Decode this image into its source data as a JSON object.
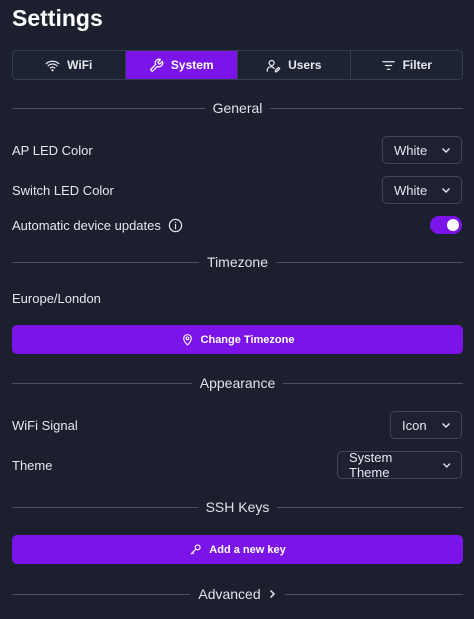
{
  "page": {
    "title": "Settings"
  },
  "tabs": [
    {
      "label": "WiFi",
      "icon": "wifi-icon",
      "active": false
    },
    {
      "label": "System",
      "icon": "wrench-icon",
      "active": true
    },
    {
      "label": "Users",
      "icon": "users-icon",
      "active": false
    },
    {
      "label": "Filter",
      "icon": "filter-icon",
      "active": false
    }
  ],
  "sections": {
    "general": "General",
    "timezone": "Timezone",
    "appearance": "Appearance",
    "ssh_keys": "SSH Keys",
    "advanced": "Advanced"
  },
  "general": {
    "ap_led_label": "AP LED Color",
    "ap_led_value": "White",
    "switch_led_label": "Switch LED Color",
    "switch_led_value": "White",
    "auto_updates_label": "Automatic device updates",
    "auto_updates_enabled": true
  },
  "timezone": {
    "current": "Europe/London",
    "change_button": "Change Timezone"
  },
  "appearance": {
    "wifi_signal_label": "WiFi Signal",
    "wifi_signal_value": "Icon",
    "theme_label": "Theme",
    "theme_value": "System Theme"
  },
  "ssh": {
    "add_button": "Add a new key"
  },
  "colors": {
    "background": "#1b1f2e",
    "accent": "#7b14e8",
    "border": "#414759",
    "text": "#e6e8ee"
  }
}
